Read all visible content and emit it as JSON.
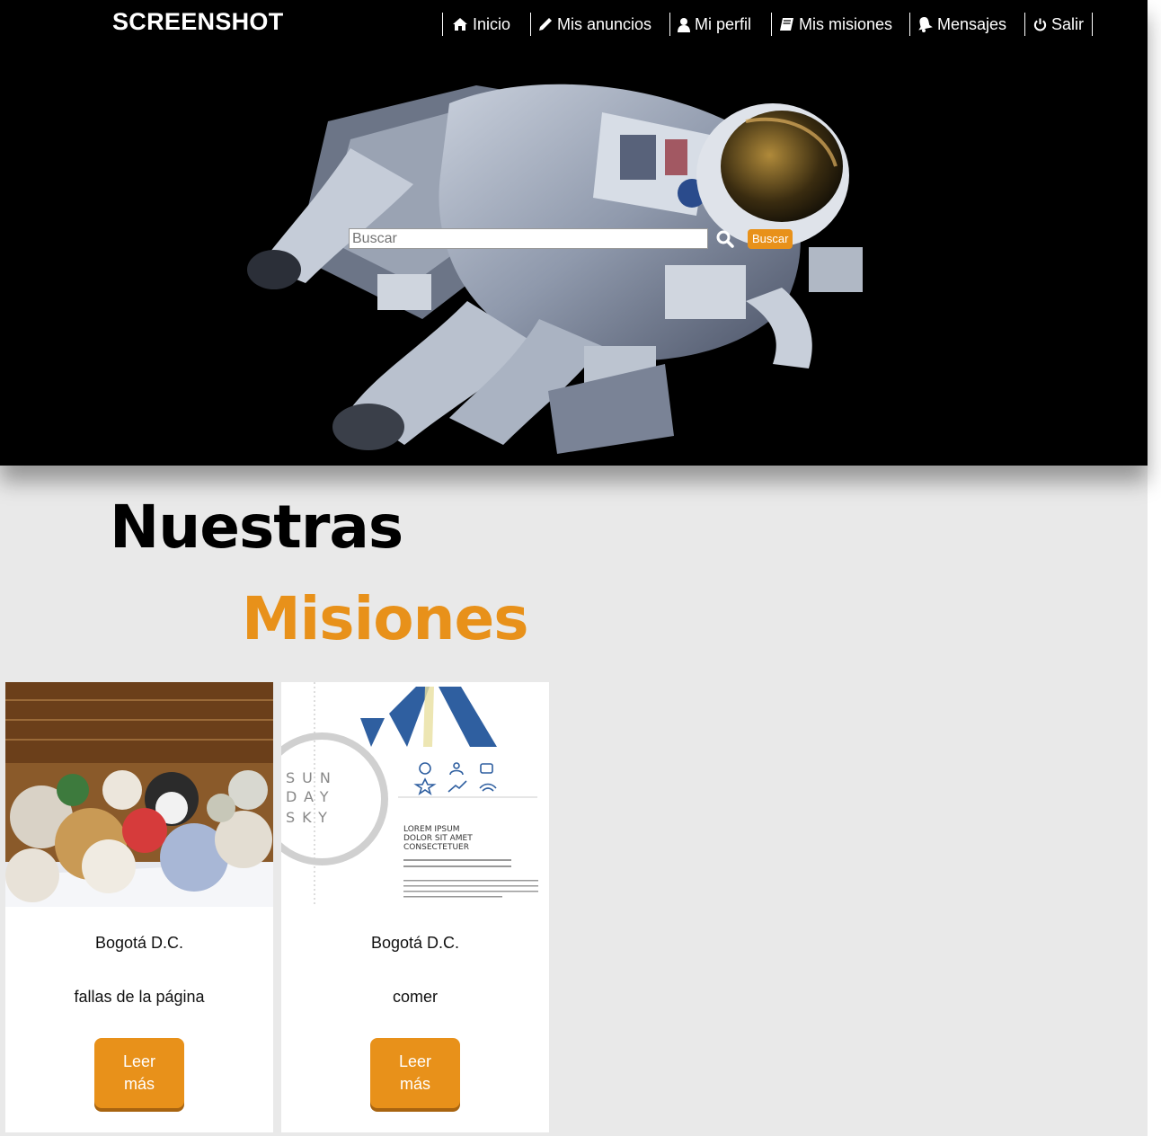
{
  "header": {
    "brand": "SCREENSHOT",
    "nav": [
      {
        "label": "Inicio",
        "icon": "home-icon"
      },
      {
        "label": "Mis anuncios",
        "icon": "pencil-icon"
      },
      {
        "label": "Mi perfil",
        "icon": "user-icon"
      },
      {
        "label": "Mis misiones",
        "icon": "book-icon"
      },
      {
        "label": "Mensajes",
        "icon": "bell-icon"
      },
      {
        "label": "Salir",
        "icon": "power-icon"
      }
    ]
  },
  "search": {
    "placeholder": "Buscar",
    "button_label": "Buscar"
  },
  "section": {
    "title_line1": "Nuestras",
    "title_line2": "Misiones"
  },
  "cards": [
    {
      "city": "Bogotá D.C.",
      "description": "fallas de la página",
      "button_label": "Leer más"
    },
    {
      "city": "Bogotá D.C.",
      "description": "comer",
      "button_label": "Leer más"
    }
  ],
  "card2_image_text": {
    "letters": "SUN DAY SKY",
    "lorem": "LOREM IPSUM DOLOR SIT AMET CONSECTETUER"
  },
  "colors": {
    "accent": "#e8911a",
    "header_bg": "#000000",
    "page_bg": "#e9e9e9"
  }
}
